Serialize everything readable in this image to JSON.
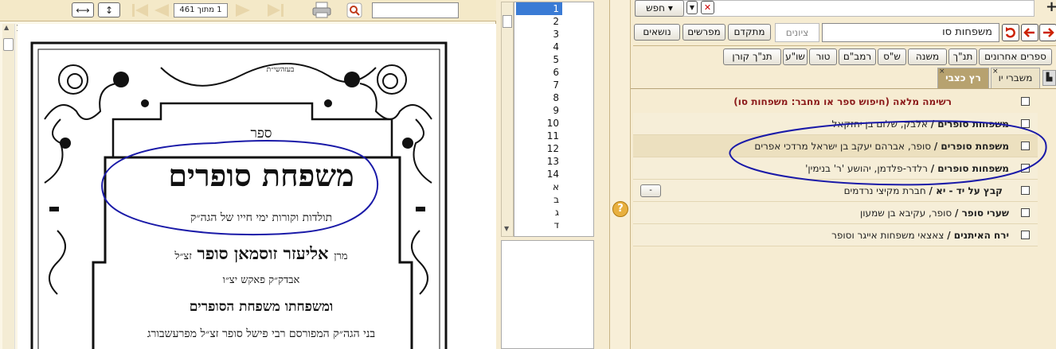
{
  "viewer": {
    "page_indicator": "1 מתוך 461",
    "find_value": "",
    "page_number": "1",
    "book": {
      "top_label": "בעזהשי״ת",
      "sefer": "ספר",
      "title": "משפחת סופרים",
      "subtitle": "תולדות וקורות ימי חייו של הגה״ק",
      "line1_prefix": "מרן",
      "line1_name": "אליעזר זוסמאן סופר",
      "line1_suffix": "זצ״ל",
      "line2": "אבדק״ק פאקש יצ״ו",
      "line3": "ומשפחתו משפחת הסופרים",
      "line4": "בני הגה״ק המפורסם רבי פישל סופר זצ״ל מפרעשבורג"
    }
  },
  "numlist": {
    "items": [
      "1",
      "2",
      "3",
      "4",
      "5",
      "6",
      "7",
      "8",
      "9",
      "10",
      "11",
      "12",
      "13",
      "14",
      "א",
      "ב",
      "ג",
      "ד"
    ],
    "selected": "1"
  },
  "right": {
    "search_label": "חפש",
    "search_value": "משפחות סו",
    "tziyun_placeholder": "ציונים",
    "buttons": [
      "מתקדם",
      "מפרשים",
      "נושאים"
    ],
    "categories_row1": [
      "ספרים אחרונים",
      "תנ\"ך",
      "משנה",
      "ש\"ס",
      "רמב\"ם",
      "טור",
      "שו\"ע",
      "תנ\"ך קורן"
    ],
    "tabs": [
      "משברי יו",
      "רץ כצבי"
    ],
    "list_header": "רשימה מלאה (חיפוש  ספר או מחבר: משפחות סו)",
    "results": [
      {
        "title": "משפחות סופרים /",
        "author": "אלבק, שלום בן יחזקאל"
      },
      {
        "title": "משפחת סופרים /",
        "author": "סופר, אברהם יעקב בן ישראל מרדכי אפרים"
      },
      {
        "title": "משפחות סופרים /",
        "author": "רלדר-פלדמן, יהושע 'ר' בנימין'"
      },
      {
        "title": "קבץ על יד - יא /",
        "author": "חברת מקיצי נרדמים",
        "collapse": "-"
      },
      {
        "title": "שערי סופר /",
        "author": "סופר, עקיבא בן שמעון"
      },
      {
        "title": "ירח האיתנים /",
        "author": "צאצאי משפחות אייגר וסופר"
      }
    ],
    "help_icon": "question-icon"
  },
  "colors": {
    "panel_bg": "#f6ecd2",
    "annotation": "#1a1aa8",
    "header_text": "#8b1a1a",
    "nav_red": "#cc2200"
  }
}
